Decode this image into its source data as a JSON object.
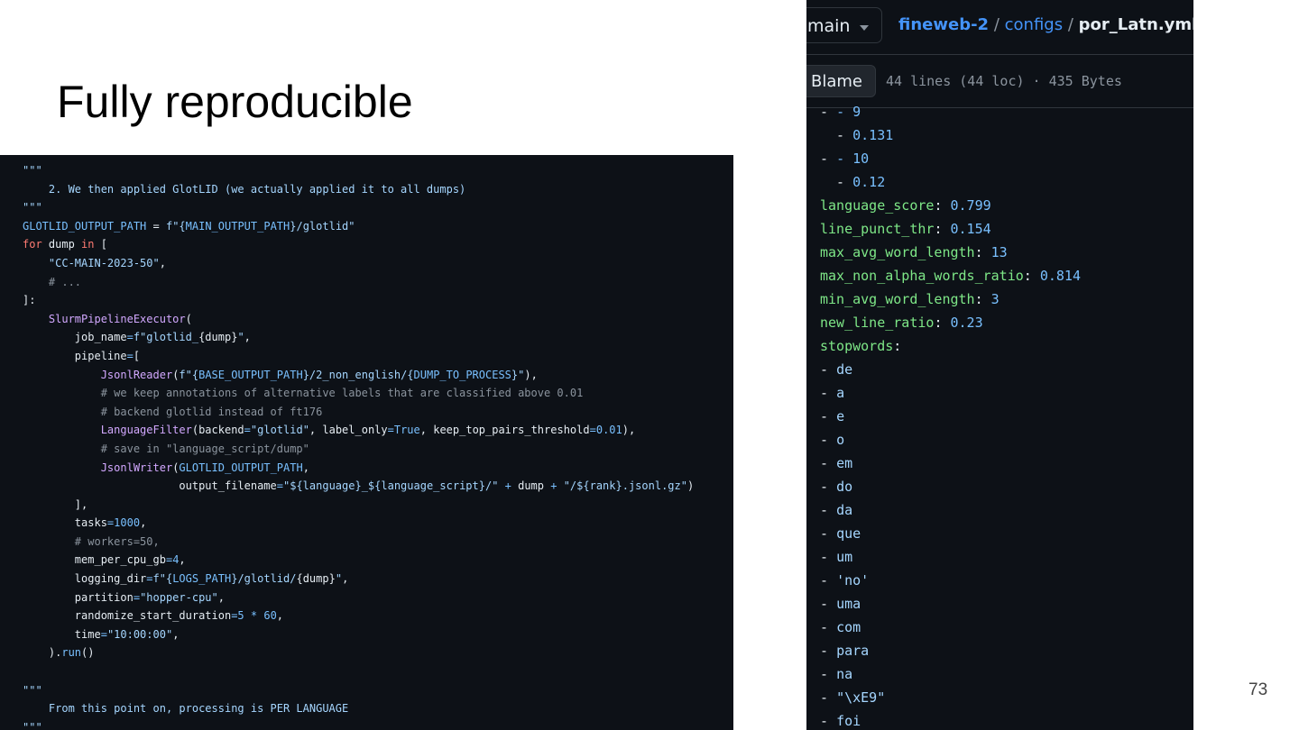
{
  "slide": {
    "title": "Fully reproducible",
    "page_number": "73"
  },
  "code_panel": {
    "lines": [
      [
        {
          "t": "\"\"\"",
          "c": "s"
        }
      ],
      [
        {
          "t": "    2. We then applied GlotLID (we actually applied it to all dumps)",
          "c": "s"
        }
      ],
      [
        {
          "t": "\"\"\"",
          "c": "s"
        }
      ],
      [
        {
          "t": "GLOTLID_OUTPUT_PATH",
          "c": "n"
        },
        {
          "t": " = ",
          "c": "d"
        },
        {
          "t": "f\"{",
          "c": "s"
        },
        {
          "t": "MAIN_OUTPUT_PATH",
          "c": "n"
        },
        {
          "t": "}/glotlid\"",
          "c": "s"
        }
      ],
      [
        {
          "t": "for",
          "c": "k"
        },
        {
          "t": " dump ",
          "c": "d"
        },
        {
          "t": "in",
          "c": "k"
        },
        {
          "t": " [",
          "c": "d"
        }
      ],
      [
        {
          "t": "    ",
          "c": "d"
        },
        {
          "t": "\"CC-MAIN-2023-50\"",
          "c": "s"
        },
        {
          "t": ",",
          "c": "d"
        }
      ],
      [
        {
          "t": "    # ...",
          "c": "c"
        }
      ],
      [
        {
          "t": "]:",
          "c": "d"
        }
      ],
      [
        {
          "t": "    ",
          "c": "d"
        },
        {
          "t": "SlurmPipelineExecutor",
          "c": "f"
        },
        {
          "t": "(",
          "c": "d"
        }
      ],
      [
        {
          "t": "        job_name",
          "c": "d"
        },
        {
          "t": "=",
          "c": "n"
        },
        {
          "t": "f\"glotlid_",
          "c": "s"
        },
        {
          "t": "{dump}",
          "c": "d"
        },
        {
          "t": "\"",
          "c": "s"
        },
        {
          "t": ",",
          "c": "d"
        }
      ],
      [
        {
          "t": "        pipeline",
          "c": "d"
        },
        {
          "t": "=",
          "c": "n"
        },
        {
          "t": "[",
          "c": "d"
        }
      ],
      [
        {
          "t": "            ",
          "c": "d"
        },
        {
          "t": "JsonlReader",
          "c": "f"
        },
        {
          "t": "(",
          "c": "d"
        },
        {
          "t": "f\"{",
          "c": "s"
        },
        {
          "t": "BASE_OUTPUT_PATH",
          "c": "n"
        },
        {
          "t": "}/2_non_english/{",
          "c": "s"
        },
        {
          "t": "DUMP_TO_PROCESS",
          "c": "n"
        },
        {
          "t": "}\"",
          "c": "s"
        },
        {
          "t": "),",
          "c": "d"
        }
      ],
      [
        {
          "t": "            # we keep annotations of alternative labels that are classified above 0.01",
          "c": "c"
        }
      ],
      [
        {
          "t": "            # backend glotlid instead of ft176",
          "c": "c"
        }
      ],
      [
        {
          "t": "            ",
          "c": "d"
        },
        {
          "t": "LanguageFilter",
          "c": "f"
        },
        {
          "t": "(backend",
          "c": "d"
        },
        {
          "t": "=",
          "c": "n"
        },
        {
          "t": "\"glotlid\"",
          "c": "s"
        },
        {
          "t": ", label_only",
          "c": "d"
        },
        {
          "t": "=",
          "c": "n"
        },
        {
          "t": "True",
          "c": "n"
        },
        {
          "t": ", keep_top_pairs_threshold",
          "c": "d"
        },
        {
          "t": "=",
          "c": "n"
        },
        {
          "t": "0.01",
          "c": "n"
        },
        {
          "t": "),",
          "c": "d"
        }
      ],
      [
        {
          "t": "            # save in \"language_script/dump\"",
          "c": "c"
        }
      ],
      [
        {
          "t": "            ",
          "c": "d"
        },
        {
          "t": "JsonlWriter",
          "c": "f"
        },
        {
          "t": "(",
          "c": "d"
        },
        {
          "t": "GLOTLID_OUTPUT_PATH",
          "c": "n"
        },
        {
          "t": ",",
          "c": "d"
        }
      ],
      [
        {
          "t": "                        output_filename",
          "c": "d"
        },
        {
          "t": "=",
          "c": "n"
        },
        {
          "t": "\"${language}_${language_script}/\"",
          "c": "s"
        },
        {
          "t": " + ",
          "c": "n"
        },
        {
          "t": "dump",
          "c": "d"
        },
        {
          "t": " + ",
          "c": "n"
        },
        {
          "t": "\"/${rank}.jsonl.gz\"",
          "c": "s"
        },
        {
          "t": ")",
          "c": "d"
        }
      ],
      [
        {
          "t": "        ],",
          "c": "d"
        }
      ],
      [
        {
          "t": "        tasks",
          "c": "d"
        },
        {
          "t": "=",
          "c": "n"
        },
        {
          "t": "1000",
          "c": "n"
        },
        {
          "t": ",",
          "c": "d"
        }
      ],
      [
        {
          "t": "        # workers=50,",
          "c": "c"
        }
      ],
      [
        {
          "t": "        mem_per_cpu_gb",
          "c": "d"
        },
        {
          "t": "=",
          "c": "n"
        },
        {
          "t": "4",
          "c": "n"
        },
        {
          "t": ",",
          "c": "d"
        }
      ],
      [
        {
          "t": "        logging_dir",
          "c": "d"
        },
        {
          "t": "=",
          "c": "n"
        },
        {
          "t": "f\"{",
          "c": "s"
        },
        {
          "t": "LOGS_PATH",
          "c": "n"
        },
        {
          "t": "}/glotlid/",
          "c": "s"
        },
        {
          "t": "{dump}",
          "c": "d"
        },
        {
          "t": "\"",
          "c": "s"
        },
        {
          "t": ",",
          "c": "d"
        }
      ],
      [
        {
          "t": "        partition",
          "c": "d"
        },
        {
          "t": "=",
          "c": "n"
        },
        {
          "t": "\"hopper-cpu\"",
          "c": "s"
        },
        {
          "t": ",",
          "c": "d"
        }
      ],
      [
        {
          "t": "        randomize_start_duration",
          "c": "d"
        },
        {
          "t": "=",
          "c": "n"
        },
        {
          "t": "5",
          "c": "n"
        },
        {
          "t": " * ",
          "c": "n"
        },
        {
          "t": "60",
          "c": "n"
        },
        {
          "t": ",",
          "c": "d"
        }
      ],
      [
        {
          "t": "        time",
          "c": "d"
        },
        {
          "t": "=",
          "c": "n"
        },
        {
          "t": "\"10:00:00\"",
          "c": "s"
        },
        {
          "t": ",",
          "c": "d"
        }
      ],
      [
        {
          "t": "    ).",
          "c": "d"
        },
        {
          "t": "run",
          "c": "n"
        },
        {
          "t": "()",
          "c": "d"
        }
      ],
      [],
      [
        {
          "t": "\"\"\"",
          "c": "s"
        }
      ],
      [
        {
          "t": "    From this point on, processing is PER LANGUAGE",
          "c": "s"
        }
      ],
      [
        {
          "t": "\"\"\"",
          "c": "s"
        }
      ]
    ]
  },
  "github": {
    "branch": "main",
    "breadcrumb": {
      "repo": "fineweb-2",
      "folder": "configs",
      "file": "por_Latn.yml",
      "separator": "/"
    },
    "blame_label": "Blame",
    "file_info": "44 lines (44 loc) · 435 Bytes",
    "yaml_lines": [
      [
        {
          "t": "- ",
          "c": "p"
        },
        {
          "t": "- 9",
          "c": "v"
        }
      ],
      [
        {
          "t": "  - ",
          "c": "p"
        },
        {
          "t": "0.131",
          "c": "v"
        }
      ],
      [
        {
          "t": "- ",
          "c": "p"
        },
        {
          "t": "- 10",
          "c": "v"
        }
      ],
      [
        {
          "t": "  - ",
          "c": "p"
        },
        {
          "t": "0.12",
          "c": "v"
        }
      ],
      [
        {
          "t": "language_score",
          "c": "k"
        },
        {
          "t": ": ",
          "c": "p"
        },
        {
          "t": "0.799",
          "c": "v"
        }
      ],
      [
        {
          "t": "line_punct_thr",
          "c": "k"
        },
        {
          "t": ": ",
          "c": "p"
        },
        {
          "t": "0.154",
          "c": "v"
        }
      ],
      [
        {
          "t": "max_avg_word_length",
          "c": "k"
        },
        {
          "t": ": ",
          "c": "p"
        },
        {
          "t": "13",
          "c": "v"
        }
      ],
      [
        {
          "t": "max_non_alpha_words_ratio",
          "c": "k"
        },
        {
          "t": ": ",
          "c": "p"
        },
        {
          "t": "0.814",
          "c": "v"
        }
      ],
      [
        {
          "t": "min_avg_word_length",
          "c": "k"
        },
        {
          "t": ": ",
          "c": "p"
        },
        {
          "t": "3",
          "c": "v"
        }
      ],
      [
        {
          "t": "new_line_ratio",
          "c": "k"
        },
        {
          "t": ": ",
          "c": "p"
        },
        {
          "t": "0.23",
          "c": "v"
        }
      ],
      [
        {
          "t": "stopwords",
          "c": "k"
        },
        {
          "t": ":",
          "c": "p"
        }
      ],
      [
        {
          "t": "- ",
          "c": "p"
        },
        {
          "t": "de",
          "c": "s"
        }
      ],
      [
        {
          "t": "- ",
          "c": "p"
        },
        {
          "t": "a",
          "c": "s"
        }
      ],
      [
        {
          "t": "- ",
          "c": "p"
        },
        {
          "t": "e",
          "c": "s"
        }
      ],
      [
        {
          "t": "- ",
          "c": "p"
        },
        {
          "t": "o",
          "c": "s"
        }
      ],
      [
        {
          "t": "- ",
          "c": "p"
        },
        {
          "t": "em",
          "c": "s"
        }
      ],
      [
        {
          "t": "- ",
          "c": "p"
        },
        {
          "t": "do",
          "c": "s"
        }
      ],
      [
        {
          "t": "- ",
          "c": "p"
        },
        {
          "t": "da",
          "c": "s"
        }
      ],
      [
        {
          "t": "- ",
          "c": "p"
        },
        {
          "t": "que",
          "c": "s"
        }
      ],
      [
        {
          "t": "- ",
          "c": "p"
        },
        {
          "t": "um",
          "c": "s"
        }
      ],
      [
        {
          "t": "- ",
          "c": "p"
        },
        {
          "t": "'no'",
          "c": "s"
        }
      ],
      [
        {
          "t": "- ",
          "c": "p"
        },
        {
          "t": "uma",
          "c": "s"
        }
      ],
      [
        {
          "t": "- ",
          "c": "p"
        },
        {
          "t": "com",
          "c": "s"
        }
      ],
      [
        {
          "t": "- ",
          "c": "p"
        },
        {
          "t": "para",
          "c": "s"
        }
      ],
      [
        {
          "t": "- ",
          "c": "p"
        },
        {
          "t": "na",
          "c": "s"
        }
      ],
      [
        {
          "t": "- ",
          "c": "p"
        },
        {
          "t": "\"\\xE9\"",
          "c": "s"
        }
      ],
      [
        {
          "t": "- ",
          "c": "p"
        },
        {
          "t": "foi",
          "c": "s"
        }
      ]
    ]
  }
}
